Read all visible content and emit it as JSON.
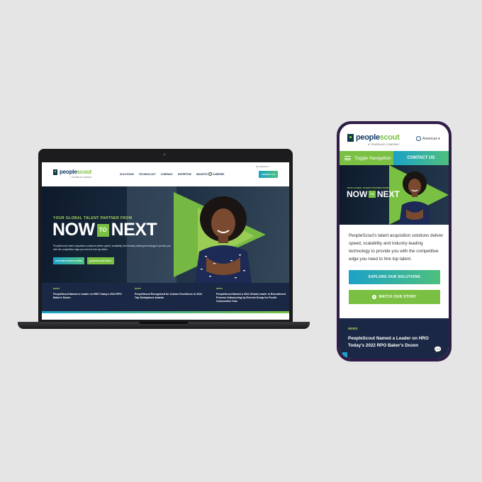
{
  "brand": {
    "name_a": "people",
    "name_b": "scout",
    "tm": "™",
    "sub": "A TRUEBLUE COMPANY"
  },
  "desktop": {
    "nav": [
      "SOLUTIONS",
      "TECHNOLOGY",
      "COMPANY",
      "EXPERTISE",
      "INSIGHTS",
      "CAREERS"
    ],
    "lang": "⊕ Americas ▾",
    "contact": "CONTACT US",
    "tagline": "YOUR GLOBAL TALENT PARTNER FROM",
    "now": "NOW",
    "to": "TO",
    "next": "NEXT",
    "description": "PeopleScout's talent acquisition solutions deliver speed, scalability and industry-leading technology to provide you with the competitive edge you need to hire top talent.",
    "btn_explore": "EXPLORE OUR SOLUTIONS",
    "btn_watch": "▶ WATCH OUR STORY",
    "news": [
      {
        "label": "NEWS",
        "title": "PeopleScout Named a Leader on HRO Today's 2022 RPO Baker's Dozen"
      },
      {
        "label": "NEWS",
        "title": "PeopleScout Recognized for Culture Excellence in 2022 Top Workplaces Awards"
      },
      {
        "label": "NEWS",
        "title": "PeopleScout Named a 2022 Global Leader in Recruitment Process Outsourcing by Everest Group for Fourth Consecutive Year"
      }
    ]
  },
  "mobile": {
    "lang": "Americas ▾",
    "toggle": "Toggle Navigation",
    "contact": "CONTACT US",
    "tagline": "YOUR GLOBAL TALENT PARTNER FROM",
    "now": "NOW",
    "to": "TO",
    "next": "NEXT",
    "description": "PeopleScout's talent acquisition solutions deliver speed, scalability and industry-leading technology to provide you with the competitive edge you need to hire top talent.",
    "btn_explore": "EXPLORE OUR SOLUTIONS",
    "btn_watch": "WATCH OUR STORY",
    "news_label": "NEWS",
    "news_title": "PeopleScout Named a Leader on HRO Today's 2022 RPO Baker's Dozen",
    "chat_icon": "chat-icon"
  },
  "colors": {
    "green": "#7ac143",
    "navy": "#1b2845",
    "blue": "#1ca2c7",
    "phone_frame": "#2f1d47"
  }
}
